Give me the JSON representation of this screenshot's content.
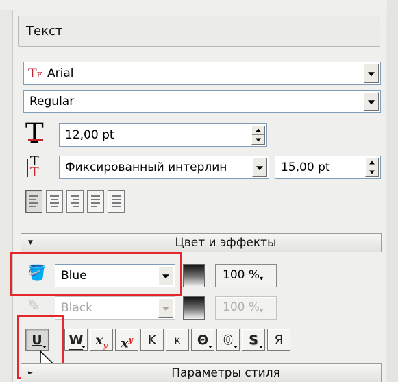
{
  "panel": {
    "title": "Текст"
  },
  "font": {
    "family": "Arial",
    "style": "Regular"
  },
  "size": {
    "value": "12,00 pt"
  },
  "leading": {
    "mode": "Фиксированный интерлин",
    "value": "15,00 pt"
  },
  "alignment": {
    "options": [
      "align-left",
      "align-center",
      "align-right",
      "justify",
      "justify-all"
    ],
    "selected": 0
  },
  "color_effects": {
    "title": "Цвет и эффекты",
    "fill": {
      "color": "Blue",
      "opacity": "100 %"
    },
    "stroke": {
      "color": "Black",
      "opacity": "100 %"
    }
  },
  "effects": {
    "buttons": [
      {
        "name": "underline",
        "label": "U"
      },
      {
        "name": "double-underline",
        "label": "W"
      },
      {
        "name": "subscript",
        "label": "x"
      },
      {
        "name": "superscript",
        "label": "x"
      },
      {
        "name": "small-caps-upper",
        "label": "K"
      },
      {
        "name": "small-caps-lower",
        "label": "к"
      },
      {
        "name": "strikethrough",
        "label": "Θ"
      },
      {
        "name": "outline",
        "label": "0"
      },
      {
        "name": "shadow",
        "label": "S"
      },
      {
        "name": "emboss",
        "label": "Я"
      }
    ],
    "subscript_marker": "y",
    "superscript_marker": "y"
  },
  "style_params": {
    "title": "Параметры стиля"
  },
  "colors": {
    "accent_red": "#e4282b",
    "field_border": "#7f9db9"
  }
}
